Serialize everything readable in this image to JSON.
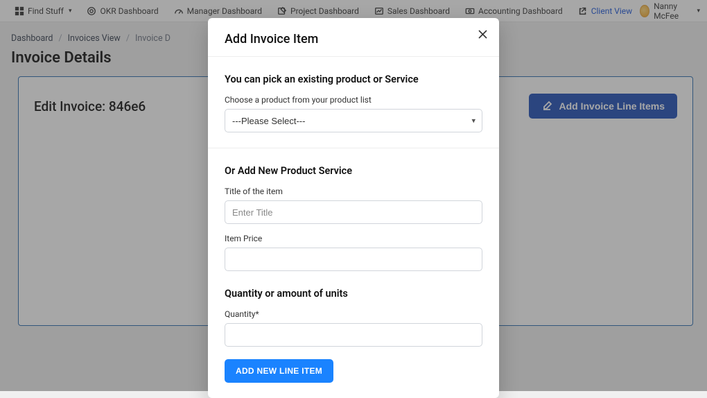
{
  "topnav": {
    "find": "Find Stuff",
    "items": [
      {
        "label": "OKR Dashboard"
      },
      {
        "label": "Manager Dashboard"
      },
      {
        "label": "Project Dashboard"
      },
      {
        "label": "Sales Dashboard"
      },
      {
        "label": "Accounting Dashboard"
      },
      {
        "label": "Client View",
        "active": true
      }
    ],
    "user": "Nanny McFee"
  },
  "breadcrumb": {
    "items": [
      "Dashboard",
      "Invoices View",
      "Invoice D"
    ]
  },
  "page": {
    "title": "Invoice Details",
    "panel_title_prefix": "Edit Invoice: ",
    "invoice_id_visible": "846e6",
    "add_line_items_btn": "Add Invoice Line Items"
  },
  "modal": {
    "title": "Add Invoice Item",
    "section_pick": "You can pick an existing product or Service",
    "choose_label": "Choose a product from your product list",
    "select_placeholder": "---Please Select---",
    "section_new": "Or Add New Product Service",
    "title_label": "Title of the item",
    "title_placeholder": "Enter Title",
    "price_label": "Item Price",
    "section_qty": "Quantity or amount of units",
    "qty_label": "Quantity*",
    "submit": "ADD NEW LINE ITEM"
  }
}
